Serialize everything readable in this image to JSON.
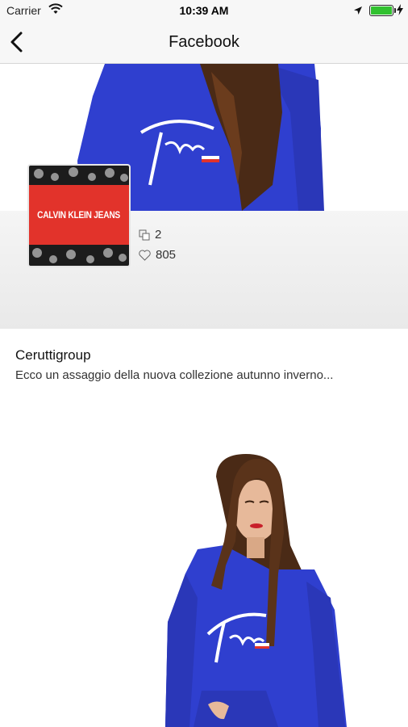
{
  "status_bar": {
    "carrier": "Carrier",
    "time": "10:39 AM",
    "battery_color": "#31c12f"
  },
  "nav": {
    "title": "Facebook",
    "back_icon": "chevron-left-icon"
  },
  "post": {
    "thumbnail_brand": "CALVIN KLEIN JEANS",
    "stats": {
      "shares": "2",
      "likes": "805"
    },
    "author": "Ceruttigroup",
    "text": "Ecco un assaggio della nuova collezione autunno inverno..."
  },
  "colors": {
    "hoodie_blue": "#2f3fcf",
    "brand_red": "#e2332b",
    "hair": "#4a2a16"
  }
}
